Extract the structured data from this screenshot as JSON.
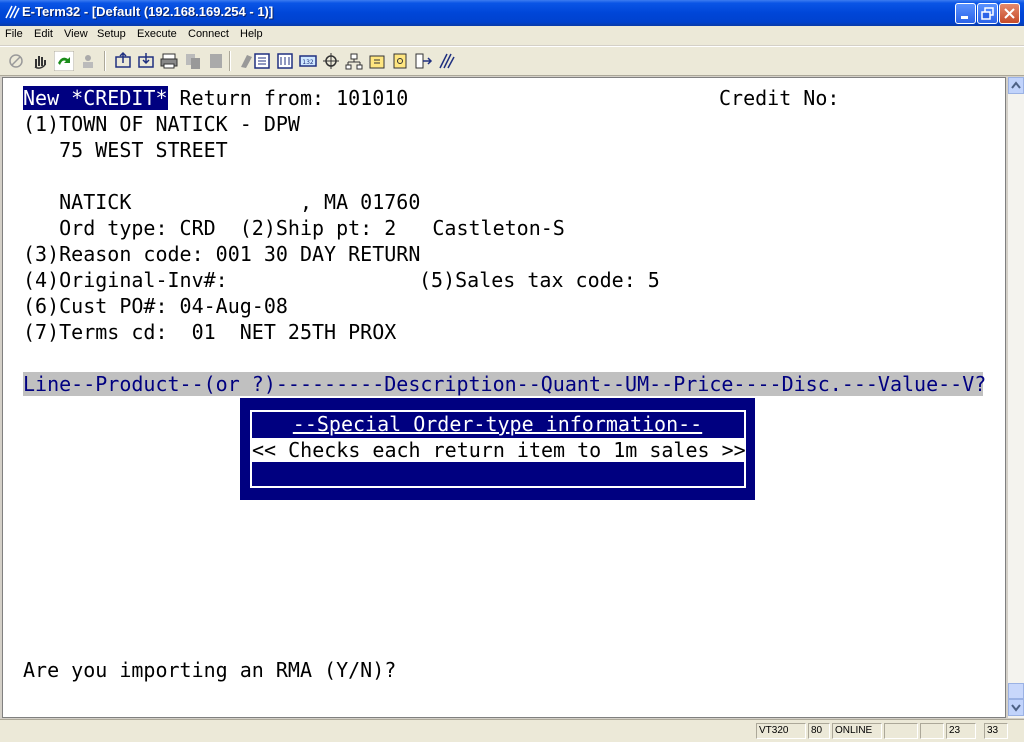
{
  "window": {
    "title": "E-Term32 - [Default (192.168.169.254 - 1)]",
    "minimize_label": "_",
    "maximize_label": "❐",
    "close_label": "✕"
  },
  "menu": {
    "file": "File",
    "edit": "Edit",
    "view": "View",
    "setup": "Setup",
    "execute": "Execute",
    "connect": "Connect",
    "help": "Help"
  },
  "screen": {
    "line1_highlight": "New *CREDIT*",
    "line1_rest": " Return from: 101010",
    "credit_no_label": "Credit No:",
    "line2": "(1)TOWN OF NATICK - DPW",
    "line3": "   75 WEST STREET",
    "line5": "   NATICK              , MA 01760",
    "line6": "   Ord type: CRD  (2)Ship pt: 2   Castleton-S",
    "line7": "(3)Reason code: 001 30 DAY RETURN",
    "line8_left": "(4)Original-Inv#:",
    "line8_right": "(5)Sales tax code: 5",
    "line9": "(6)Cust PO#: 04-Aug-08",
    "line10": "(7)Terms cd:  01  NET 25TH PROX",
    "column_header": "Line--Product--(or ?)---------Description--Quant--UM--Price----Disc.---Value--V?",
    "prompt": "Are you importing an RMA (Y/N)?"
  },
  "popup": {
    "title": "--Special Order-type information--",
    "message": "<< Checks each return item to 1m sales >>"
  },
  "status": {
    "terminal_type": "VT320",
    "columns": "80",
    "connection": "ONLINE",
    "blank1": "",
    "blank2": "",
    "row": "23",
    "col": "33"
  },
  "colors": {
    "highlight_bg": "#000080",
    "header_bg": "#c0c0c0",
    "popup_bg": "#000080"
  }
}
